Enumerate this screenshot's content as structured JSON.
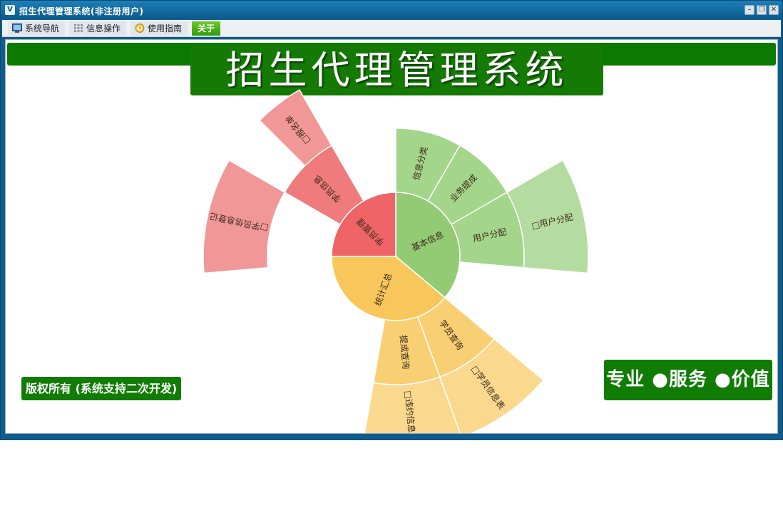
{
  "window": {
    "title": "招生代理管理系统(非注册用户)",
    "app_icon_text": "V",
    "buttons": {
      "minimize": "–",
      "restore": "❐",
      "close": "✕"
    }
  },
  "menu": {
    "items": [
      {
        "label": "系统导航",
        "icon": "monitor-icon"
      },
      {
        "label": "信息操作",
        "icon": "grid-icon"
      },
      {
        "label": "使用指南",
        "icon": "clock-icon"
      },
      {
        "label": "关于",
        "icon": ""
      }
    ]
  },
  "main": {
    "banner_title": "招生代理管理系统",
    "copyright": "版权所有 (系统支持二次开发)",
    "slogan": "专业 ●服务 ●价值"
  },
  "sunburst": {
    "colors": {
      "red_inner": "#ee6467",
      "red_mid": "#ef7b7c",
      "red_outer": "#f29798",
      "green_inner": "#92cb74",
      "green_mid": "#a3d58a",
      "green_outer": "#b4dca0",
      "orange_inner": "#f8c65a",
      "orange_mid": "#f9cf74",
      "orange_outer": "#fad98f"
    },
    "inner": [
      "学员管理",
      "基本信息",
      "统计汇总"
    ],
    "middle": [
      "学员信息",
      "信息分类",
      "业务提成",
      "用户分配",
      "学员查询",
      "提成查询"
    ],
    "outer": [
      "□报名单",
      "□学员信息登记",
      "□用户分配",
      "□学员信息表",
      "□违约信息表"
    ]
  }
}
